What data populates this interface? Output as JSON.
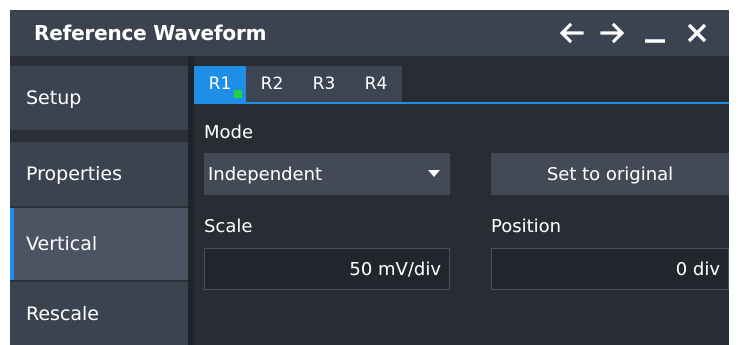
{
  "window": {
    "title": "Reference Waveform",
    "actions": [
      {
        "name": "back-arrow-icon"
      },
      {
        "name": "forward-arrow-icon"
      },
      {
        "name": "minimize-icon"
      },
      {
        "name": "close-icon"
      }
    ]
  },
  "sidebar": {
    "items": [
      {
        "label": "Setup",
        "active": false
      },
      {
        "label": "Properties",
        "active": false
      },
      {
        "label": "Vertical",
        "active": true
      },
      {
        "label": "Rescale",
        "active": false
      }
    ]
  },
  "tabs": [
    {
      "label": "R1",
      "active": true
    },
    {
      "label": "R2",
      "active": false
    },
    {
      "label": "R3",
      "active": false
    },
    {
      "label": "R4",
      "active": false
    }
  ],
  "form": {
    "mode_label": "Mode",
    "mode_value": "Independent",
    "set_original_label": "Set to original",
    "scale_label": "Scale",
    "scale_value": "50 mV/div",
    "position_label": "Position",
    "position_value": "0 div"
  },
  "colors": {
    "accent": "#1e8ee6",
    "active_indicator": "#23d140"
  }
}
